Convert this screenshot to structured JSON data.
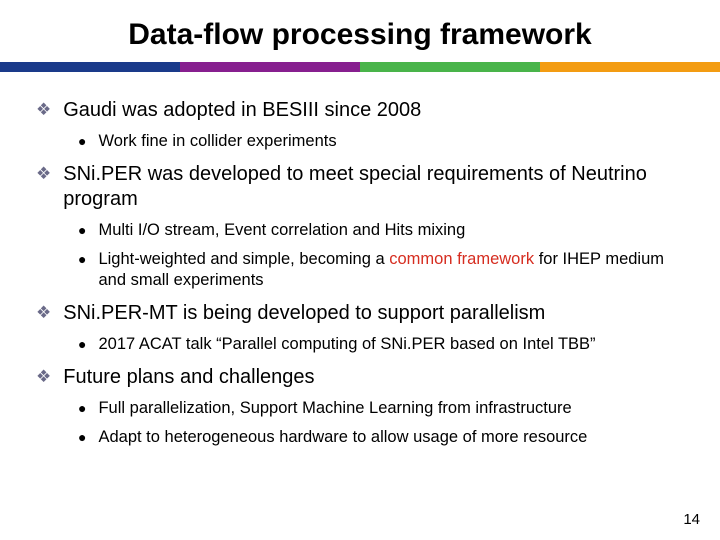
{
  "title": "Data-flow processing framework",
  "bullets": {
    "b1": {
      "text": "Gaudi was adopted in BESIII since 2008",
      "sub1": "Work fine in collider experiments"
    },
    "b2": {
      "text": "SNi.PER was developed to meet special requirements of Neutrino program",
      "sub1": "Multi I/O stream, Event correlation and Hits mixing",
      "sub2a": "Light-weighted and simple, becoming a ",
      "sub2b": "common framework",
      "sub2c": " for IHEP medium and small experiments"
    },
    "b3": {
      "text": "SNi.PER-MT is being developed to support parallelism",
      "sub1": "2017 ACAT talk “Parallel computing of SNi.PER based on Intel TBB”"
    },
    "b4": {
      "text": "Future plans and challenges",
      "sub1": "Full parallelization, Support Machine Learning from infrastructure",
      "sub2": "Adapt to heterogeneous hardware to allow usage of more resource"
    }
  },
  "page_number": "14"
}
